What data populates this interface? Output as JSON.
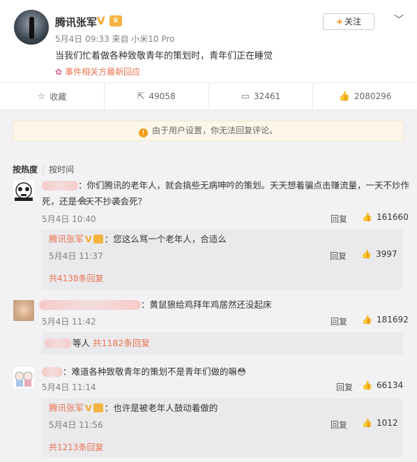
{
  "post": {
    "author": "腾讯张军",
    "verified_icon": "V",
    "level_icon": "VIP",
    "meta": "5月4日 09:33 来自 小米10 Pro",
    "follow_label": "关注",
    "more_icon": "chevron-down-icon",
    "text": "当我们忙着做各种致敬青年的策划时，青年们正在睡觉",
    "topic": "事件相关方最新回应"
  },
  "actions": [
    {
      "icon": "star-icon",
      "label": "收藏"
    },
    {
      "icon": "repost-icon",
      "label": "49058"
    },
    {
      "icon": "comment-icon",
      "label": "32461"
    },
    {
      "icon": "thumb-up-icon",
      "label": "2080296"
    }
  ],
  "notice": "由于用户设置，你无法回复评论。",
  "sort": {
    "active": "按热度",
    "other": "按时间"
  },
  "comments": [
    {
      "text_line1": "：你们腾讯的老年人，就会搞些无病呻吟的策划。天天想着骗点击赚流量，一天不炒作会",
      "text_line2": "死，还是一天不抄袭会死？",
      "time": "5月4日 10:40",
      "reply": "回复",
      "likes": "161660",
      "sub": {
        "name": "腾讯张军",
        "text": "：您这么骂一个老年人，合适么",
        "time": "5月4日 11:37",
        "reply": "回复",
        "likes": "3997",
        "more": "共4138条回复"
      }
    },
    {
      "text": "：黄鼠狼给鸡拜年鸡居然还没起床",
      "time": "5月4日 11:42",
      "reply": "回复",
      "likes": "181692",
      "sub_prefix": "等人",
      "sub_more": "共1182条回复"
    },
    {
      "text": "：难道各种致敬青年的策划不是青年们做的嘛",
      "emoji": "😳",
      "time": "5月4日 11:14",
      "reply": "回复",
      "likes": "66134",
      "sub": {
        "name": "腾讯张军",
        "text": "：也许是被老年人鼓动着做的",
        "time": "5月4日 11:56",
        "reply": "回复",
        "likes": "1012",
        "more": "共1213条回复"
      }
    }
  ]
}
